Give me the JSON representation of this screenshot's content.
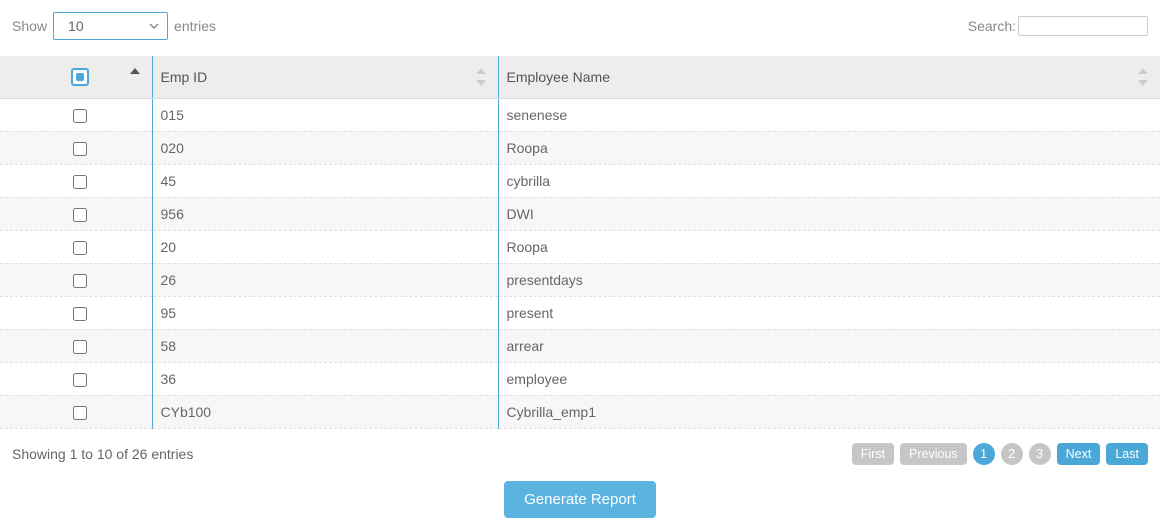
{
  "lengthCtrl": {
    "show": "Show",
    "value": "10",
    "entries": "entries"
  },
  "searchCtrl": {
    "label": "Search:",
    "value": ""
  },
  "columns": {
    "chk": "",
    "id": "Emp ID",
    "name": "Employee Name"
  },
  "rows": [
    {
      "id": "015",
      "name": "senenese"
    },
    {
      "id": "020",
      "name": "Roopa"
    },
    {
      "id": "45",
      "name": "cybrilla"
    },
    {
      "id": "956",
      "name": "DWI"
    },
    {
      "id": "20",
      "name": "Roopa"
    },
    {
      "id": "26",
      "name": "presentdays"
    },
    {
      "id": "95",
      "name": "present"
    },
    {
      "id": "58",
      "name": "arrear"
    },
    {
      "id": "36",
      "name": "employee"
    },
    {
      "id": "CYb100",
      "name": "Cybrilla_emp1"
    }
  ],
  "info": "Showing 1 to 10 of 26 entries",
  "pager": {
    "first": "First",
    "prev": "Previous",
    "next": "Next",
    "last": "Last",
    "pages": [
      "1",
      "2",
      "3"
    ],
    "current": 1
  },
  "generate": "Generate Report"
}
